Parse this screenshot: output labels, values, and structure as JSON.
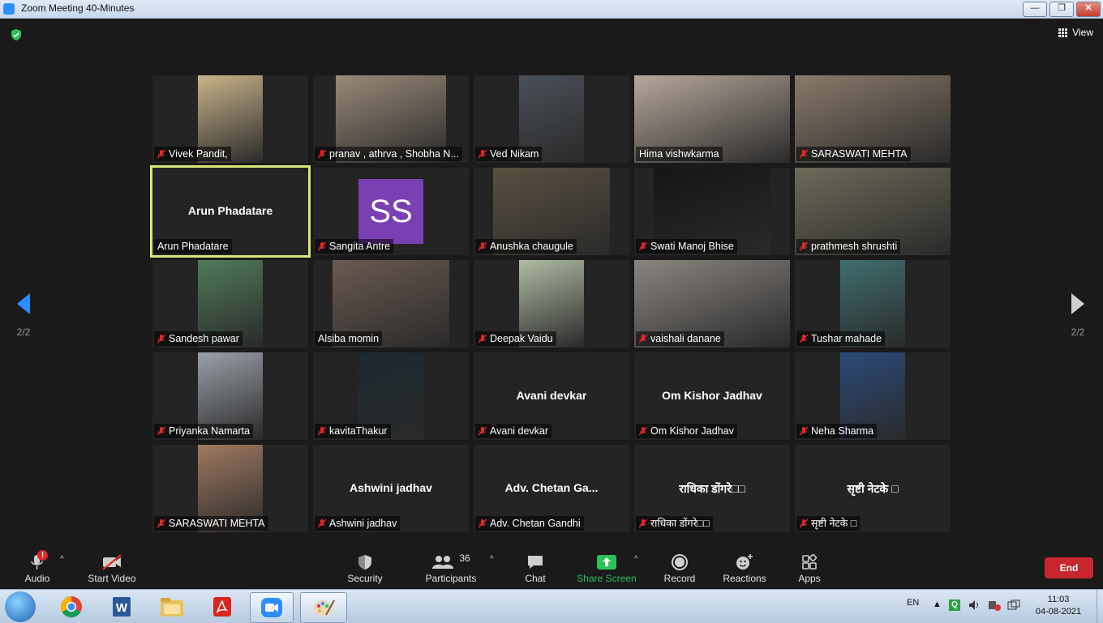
{
  "window": {
    "title": "Zoom Meeting 40-Minutes",
    "min": "—",
    "max": "❐",
    "close": "✕"
  },
  "header": {
    "view_label": "View"
  },
  "pagination": {
    "left_page": "2/2",
    "right_page": "2/2"
  },
  "participants": [
    {
      "name": "⁣Vivek  Pandit,⁣",
      "type": "video",
      "bg": "#c9b48a",
      "muted": true
    },
    {
      "name": "pranav , athrva , Shobha N...",
      "type": "video",
      "bg": "#9a8a78",
      "muted": true
    },
    {
      "name": "Ved Nikam",
      "type": "video",
      "bg": "#4a5058",
      "muted": true
    },
    {
      "name": "Hima vishwkarma",
      "type": "video",
      "bg": "#b7a89a",
      "muted": false
    },
    {
      "name": "SARASWATI MEHTA",
      "type": "video",
      "bg": "#8a7a6a",
      "muted": true
    },
    {
      "name": "Arun Phadatare",
      "type": "name",
      "display": "Arun Phadatare",
      "muted": false,
      "active": true
    },
    {
      "name": "Sangita Antre",
      "type": "avatar",
      "initials": "SS",
      "muted": true
    },
    {
      "name": "Anushka chaugule",
      "type": "video",
      "bg": "#5a5040",
      "muted": true
    },
    {
      "name": "Swati  Manoj  Bhise",
      "type": "video",
      "bg": "#151515",
      "muted": true
    },
    {
      "name": "prathmesh shrushti",
      "type": "video",
      "bg": "#6d6a58",
      "muted": true
    },
    {
      "name": "Sandesh pawar",
      "type": "video",
      "bg": "#4f7a5a",
      "muted": true
    },
    {
      "name": "Alsiba momin",
      "type": "video",
      "bg": "#6a5a50",
      "muted": false
    },
    {
      "name": "Deepak Vaidu",
      "type": "video",
      "bg": "#b0bca4",
      "muted": true
    },
    {
      "name": "vaishali danane",
      "type": "video",
      "bg": "#8a8580",
      "muted": true
    },
    {
      "name": "Tushar mahade",
      "type": "video",
      "bg": "#3f6e6e",
      "muted": true
    },
    {
      "name": "Priyanka Namarta",
      "type": "video",
      "bg": "#9aa0a8",
      "muted": true
    },
    {
      "name": "kavitaThakur",
      "type": "video",
      "bg": "#1c2a30",
      "muted": true
    },
    {
      "name": "Avani devkar",
      "type": "name",
      "display": "Avani devkar",
      "muted": true
    },
    {
      "name": "Om Kishor Jadhav",
      "type": "name",
      "display": "Om Kishor Jadhav",
      "muted": true
    },
    {
      "name": "Neha Sharma",
      "type": "video",
      "bg": "#2a4a7a",
      "muted": true
    },
    {
      "name": "SARASWATI MEHTA",
      "type": "video",
      "bg": "#a07a60",
      "muted": true
    },
    {
      "name": "Ashwini jadhav",
      "type": "name",
      "display": "Ashwini jadhav",
      "muted": true
    },
    {
      "name": "Adv. Chetan Gandhi",
      "type": "name",
      "display": "Adv. Chetan Ga...",
      "muted": true
    },
    {
      "name": "राधिका डोंगरे□□",
      "type": "name",
      "display": "राधिका डोंगरे□□",
      "muted": true
    },
    {
      "name": "सृष्टी नेटके   □",
      "type": "name",
      "display": "सृष्टी नेटके   □",
      "muted": true
    }
  ],
  "toolbar": {
    "audio": "Audio",
    "audio_alert": "!",
    "start_video": "Start Video",
    "security": "Security",
    "participants": "Participants",
    "participants_count": "36",
    "chat": "Chat",
    "share_screen": "Share Screen",
    "record": "Record",
    "reactions": "Reactions",
    "apps": "Apps",
    "end": "End"
  },
  "taskbar": {
    "apps": [
      "chrome-icon",
      "word-icon",
      "explorer-icon",
      "acrobat-icon",
      "zoom-icon",
      "paint-icon"
    ],
    "lang": "EN",
    "time": "11:03",
    "date": "04-08-2021"
  },
  "colors": {
    "accent": "#2d8cff",
    "end": "#c8262e",
    "share": "#2ec05a",
    "active_outline": "#d9e57a"
  }
}
